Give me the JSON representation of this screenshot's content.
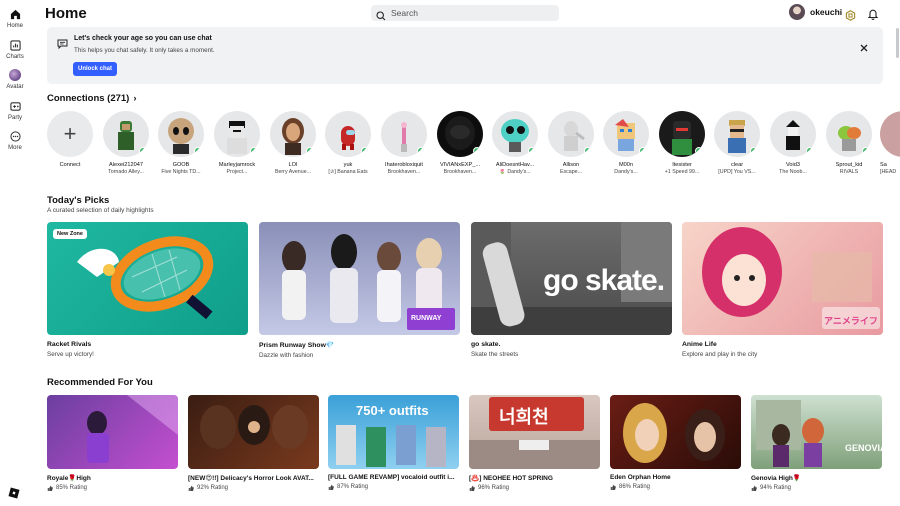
{
  "nav": {
    "items": [
      {
        "label": "Home",
        "icon": "home-icon"
      },
      {
        "label": "Charts",
        "icon": "charts-icon"
      },
      {
        "label": "Avatar",
        "icon": "avatar-icon"
      },
      {
        "label": "Party",
        "icon": "party-icon"
      },
      {
        "label": "More",
        "icon": "more-icon"
      }
    ]
  },
  "header": {
    "title": "Home",
    "search_placeholder": "Search",
    "username": "okeuchi"
  },
  "banner": {
    "title": "Let's check your age so you can use chat",
    "subtitle": "This helps you chat safely. It only takes a moment.",
    "button": "Unlock chat"
  },
  "connections": {
    "title": "Connections (271)",
    "items": [
      {
        "name": "Connect",
        "game": ""
      },
      {
        "name": "Alexei212047",
        "game": "Tornado Alley..."
      },
      {
        "name": "GOOB",
        "game": "Five Nights TD..."
      },
      {
        "name": "Marleyjamrock",
        "game": "Project..."
      },
      {
        "name": "LOI",
        "game": "Berry Avenue..."
      },
      {
        "name": "yuk",
        "game": "[✰] Banana Eats"
      },
      {
        "name": "Ihaterobloxiquit",
        "game": "Brookhaven..."
      },
      {
        "name": "VIVIANxEXP_...",
        "game": "Brookhaven..."
      },
      {
        "name": "AliDoesntHav...",
        "game": "🌷 Dandy's..."
      },
      {
        "name": "Allison",
        "game": "Escape..."
      },
      {
        "name": "M00n",
        "game": "Dandy's..."
      },
      {
        "name": "Itesister",
        "game": "+1 Speed 99..."
      },
      {
        "name": "clear",
        "game": "[UPD] You VS..."
      },
      {
        "name": "Void3",
        "game": "The Noob..."
      },
      {
        "name": "Sprout_kid",
        "game": "RIVALS"
      },
      {
        "name": "Sa",
        "game": "[HEAD"
      }
    ]
  },
  "picks": {
    "title": "Today's Picks",
    "subtitle": "A curated selection of daily highlights",
    "items": [
      {
        "title": "Racket Rivals",
        "sub": "Serve up victory!",
        "badge": "New Zone"
      },
      {
        "title": "Prism Runway Show💎",
        "sub": "Dazzle with fashion",
        "thumb_text": "RUNWAY"
      },
      {
        "title": "go skate.",
        "sub": "Skate the streets",
        "thumb_text": "go skate."
      },
      {
        "title": "Anime Life",
        "sub": "Explore and play in the city",
        "thumb_text": "アニメライフ"
      }
    ]
  },
  "recommended": {
    "title": "Recommended For You",
    "items": [
      {
        "title": "Royale🌹High",
        "rating": "85% Rating"
      },
      {
        "title": "[NEW😍!!] Delicacy's Horror Look AVAT...",
        "rating": "92% Rating"
      },
      {
        "title": "[FULL GAME REVAMP] vocaloid outfit i...",
        "rating": "87% Rating",
        "thumb_text": "750+ outfits"
      },
      {
        "title": "[♨️] NEOHEE HOT SPRING",
        "rating": "96% Rating",
        "thumb_text": "너희천"
      },
      {
        "title": "Eden Orphan Home",
        "rating": "86% Rating"
      },
      {
        "title": "Genovia High🌹",
        "rating": "94% Rating",
        "thumb_text": "GENOVIA"
      }
    ]
  }
}
